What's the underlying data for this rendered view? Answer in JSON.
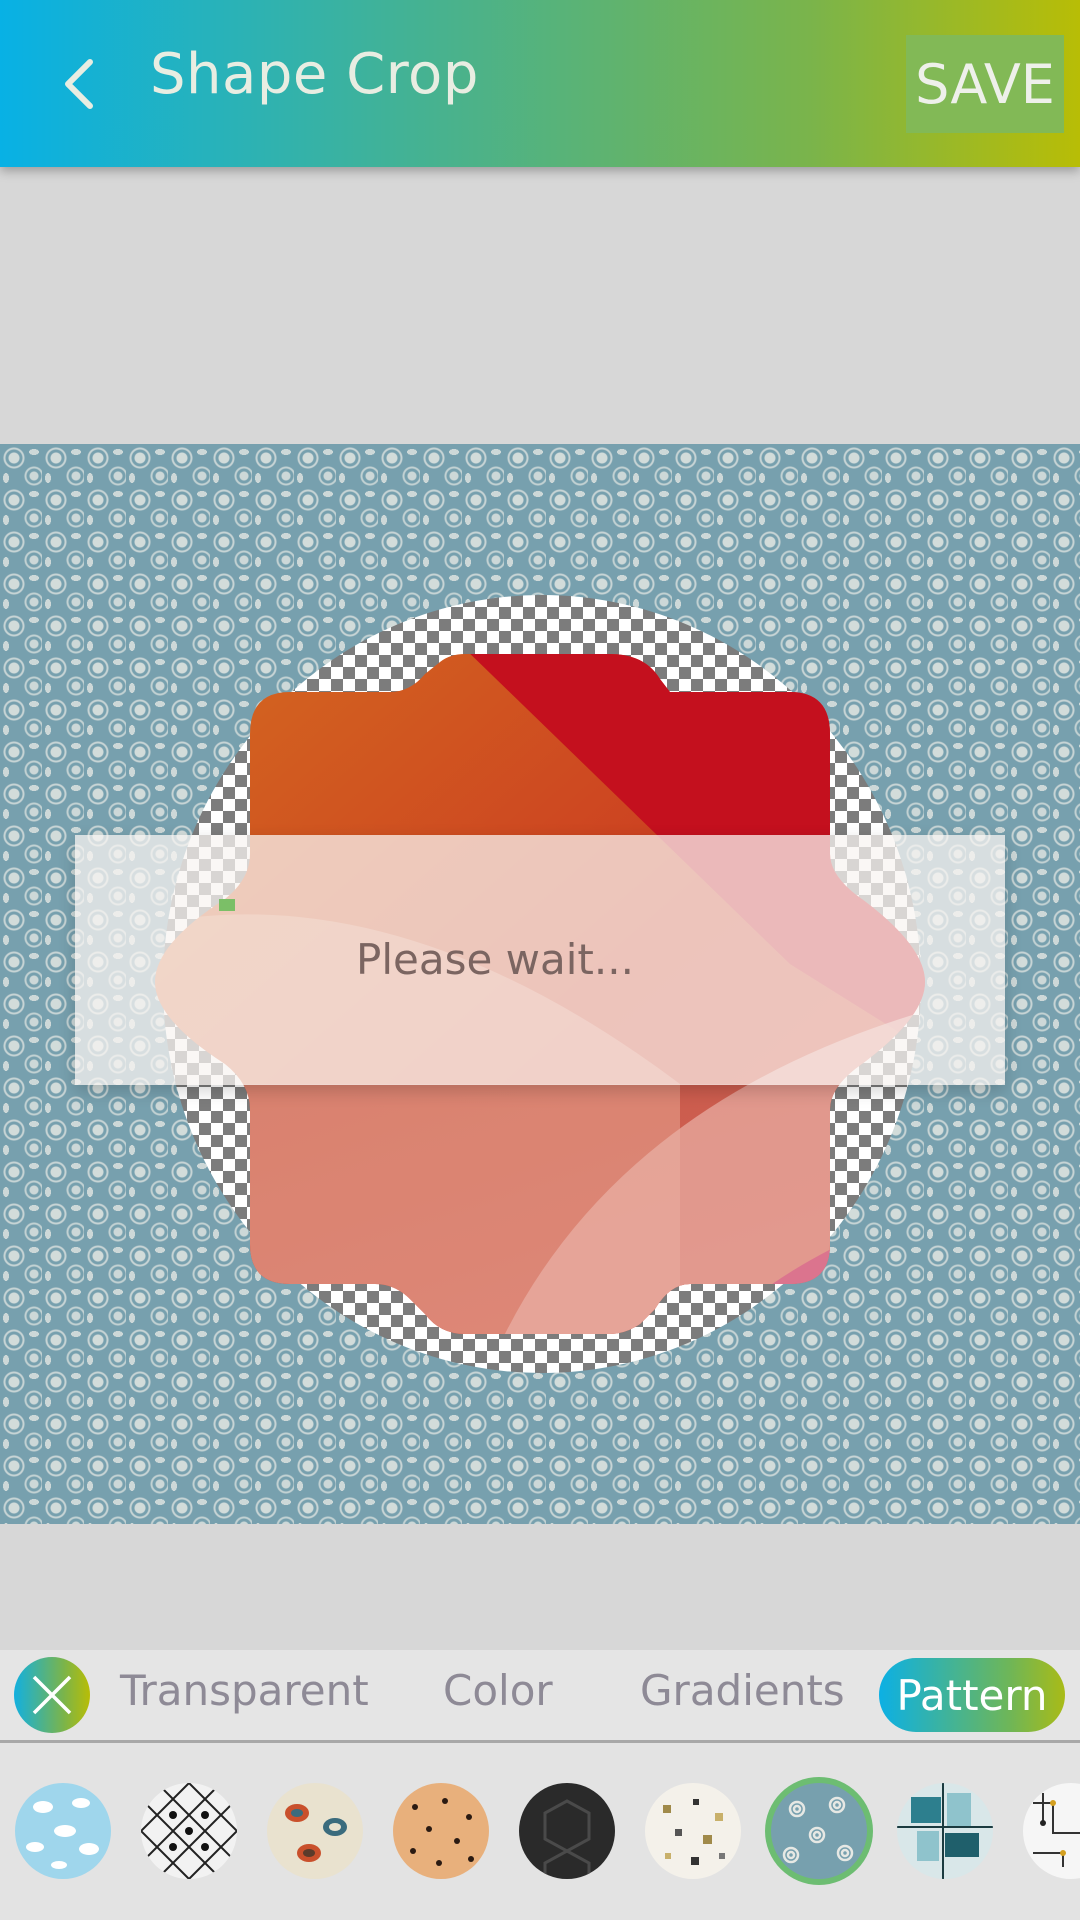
{
  "appbar": {
    "back_icon": "chevron-left-icon",
    "title": "Shape Crop",
    "save_label": "SAVE"
  },
  "dialog": {
    "message": "Please wait..."
  },
  "background_tabs": {
    "close_icon": "close-icon",
    "items": [
      {
        "label": "Transparent",
        "active": false
      },
      {
        "label": "Color",
        "active": false
      },
      {
        "label": "Gradients",
        "active": false
      },
      {
        "label": "Pattern",
        "active": true
      }
    ]
  },
  "patterns": {
    "selected_index": 6,
    "items": [
      {
        "name": "sky-clouds-pattern"
      },
      {
        "name": "black-lattice-pattern"
      },
      {
        "name": "retro-ovals-pattern"
      },
      {
        "name": "cookie-dots-pattern"
      },
      {
        "name": "dark-tiles-pattern"
      },
      {
        "name": "confetti-squares-pattern"
      },
      {
        "name": "blue-roses-pattern"
      },
      {
        "name": "teal-mosaic-pattern"
      },
      {
        "name": "circuit-lines-pattern"
      }
    ]
  },
  "colors": {
    "appbar_gradient": [
      "#08b1e5",
      "#3fb29a",
      "#7ab44b",
      "#b8bd06"
    ],
    "save_button": "#82b956",
    "selected_ring": "#6dbd72",
    "pattern_base": "#77a0ae"
  }
}
